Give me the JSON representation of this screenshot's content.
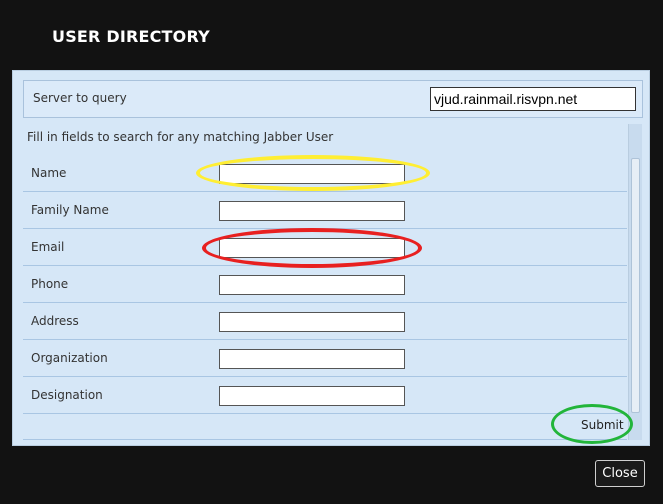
{
  "dialog": {
    "title": "USER DIRECTORY",
    "close_label": "Close"
  },
  "server": {
    "label": "Server to query",
    "value": "vjud.rainmail.risvpn.net"
  },
  "form": {
    "instructions": "Fill in fields to search for any matching Jabber User",
    "fields": [
      {
        "label": "Name",
        "value": ""
      },
      {
        "label": "Family Name",
        "value": ""
      },
      {
        "label": "Email",
        "value": ""
      },
      {
        "label": "Phone",
        "value": ""
      },
      {
        "label": "Address",
        "value": ""
      },
      {
        "label": "Organization",
        "value": ""
      },
      {
        "label": "Designation",
        "value": ""
      }
    ],
    "submit_label": "Submit"
  },
  "annotations": {
    "name_highlight_color": "#ffee33",
    "email_highlight_color": "#e82020",
    "submit_highlight_color": "#22b53a"
  }
}
